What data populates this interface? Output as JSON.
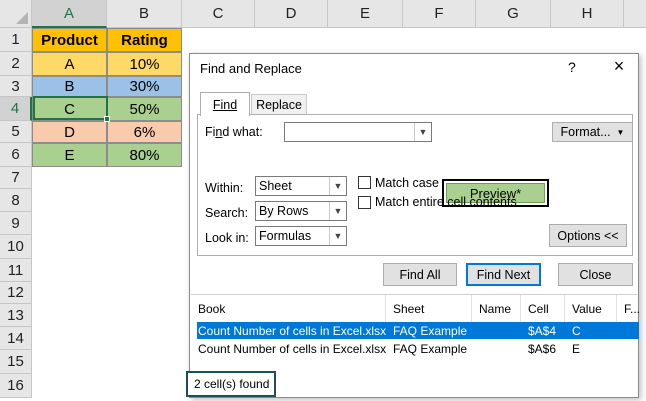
{
  "spreadsheet": {
    "columns": [
      "A",
      "B",
      "C",
      "D",
      "E",
      "F",
      "G",
      "H"
    ],
    "rows": [
      "1",
      "2",
      "3",
      "4",
      "5",
      "6",
      "7",
      "8",
      "9",
      "10",
      "11",
      "12",
      "13",
      "14",
      "15",
      "16"
    ],
    "selected_column": "A",
    "selected_row": "4",
    "header_row": [
      "Product",
      "Rating"
    ],
    "data_rows": [
      {
        "product": "A",
        "rating": "10%",
        "color": "#ffd966"
      },
      {
        "product": "B",
        "rating": "30%",
        "color": "#9bc2e6"
      },
      {
        "product": "C",
        "rating": "50%",
        "color": "#a9d08e"
      },
      {
        "product": "D",
        "rating": "6%",
        "color": "#f8cbad"
      },
      {
        "product": "E",
        "rating": "80%",
        "color": "#a9d08e"
      }
    ],
    "header_color": "#ffc000"
  },
  "dialog": {
    "title": "Find and Replace",
    "help": "?",
    "close": "×",
    "tabs": {
      "find": "Find",
      "replace": "Replace"
    },
    "find_what_label_pre": "Fi",
    "find_what_label_u": "n",
    "find_what_label_post": "d what:",
    "find_what_value": "",
    "preview_label": "Preview*",
    "format_label": "Format...",
    "within": {
      "label": "Within:",
      "value": "Sheet"
    },
    "search": {
      "label": "Search:",
      "value": "By Rows"
    },
    "look_in": {
      "label": "Look in:",
      "value": "Formulas"
    },
    "match_case": "Match case",
    "match_entire": "Match entire cell contents",
    "options_label": "Options <<",
    "find_all": "Find All",
    "find_next": "Find Next",
    "close_button": "Close",
    "result_columns": [
      "Book",
      "Sheet",
      "Name",
      "Cell",
      "Value",
      "F..."
    ],
    "results": [
      {
        "book": "Count Number of cells in Excel.xlsx",
        "sheet": "FAQ Example",
        "name": "",
        "cell": "$A$4",
        "value": "C"
      },
      {
        "book": "Count Number of cells in Excel.xlsx",
        "sheet": "FAQ Example",
        "name": "",
        "cell": "$A$6",
        "value": "E"
      }
    ],
    "status": "2 cell(s) found",
    "accent": "#0078d7"
  }
}
